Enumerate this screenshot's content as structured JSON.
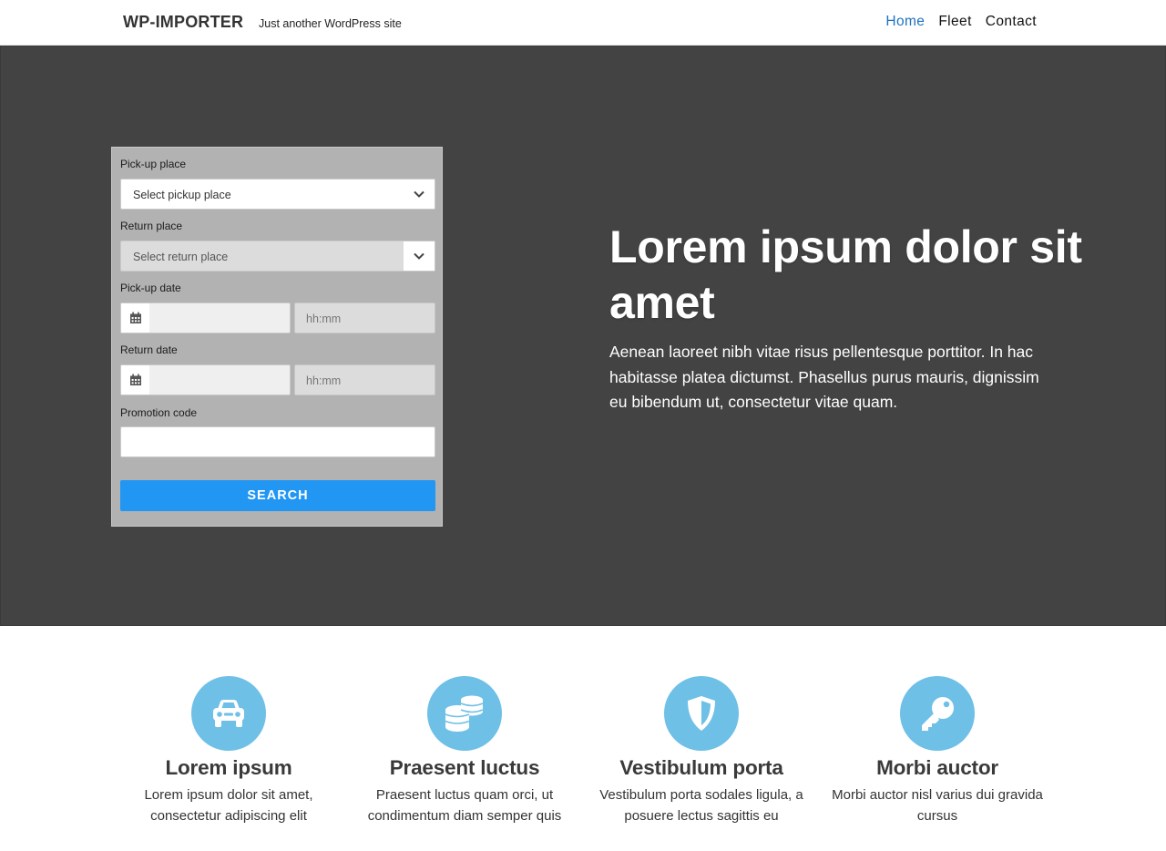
{
  "header": {
    "site_title": "WP-IMPORTER",
    "tagline": "Just another WordPress site",
    "nav": [
      "Home",
      "Fleet",
      "Contact"
    ],
    "active_nav": "Home",
    "accent_color": "#1e73be"
  },
  "booking_form": {
    "pickup_place_label": "Pick-up place",
    "pickup_place_value": "Select pickup place",
    "return_place_label": "Return place",
    "return_place_value": "Select return place",
    "pickup_date_label": "Pick-up date",
    "pickup_time_placeholder": "hh:mm",
    "return_date_label": "Return date",
    "return_time_placeholder": "hh:mm",
    "promo_label": "Promotion code",
    "search_label": "SEARCH",
    "button_color": "#2196f3",
    "icons": [
      "chevron-down-icon",
      "calendar-icon"
    ]
  },
  "hero": {
    "title": "Lorem ipsum dolor sit amet",
    "text": "Aenean laoreet nibh vitae risus pellentesque porttitor. In hac habitasse platea dictumst. Phasellus purus mauris, dignissim eu bibendum ut, consectetur vitae quam.",
    "background_color": "#434343"
  },
  "features": [
    {
      "icon": "car-icon",
      "title": "Lorem ipsum",
      "text": "Lorem ipsum dolor sit amet, consectetur adipiscing elit"
    },
    {
      "icon": "coins-icon",
      "title": "Praesent luctus",
      "text": "Praesent luctus quam orci, ut condimentum diam semper quis"
    },
    {
      "icon": "shield-icon",
      "title": "Vestibulum porta",
      "text": "Vestibulum porta sodales ligula, a posuere lectus sagittis eu"
    },
    {
      "icon": "key-icon",
      "title": "Morbi auctor",
      "text": "Morbi auctor nisl varius dui gravida cursus"
    }
  ],
  "feature_icon_color": "#6ec0e6"
}
